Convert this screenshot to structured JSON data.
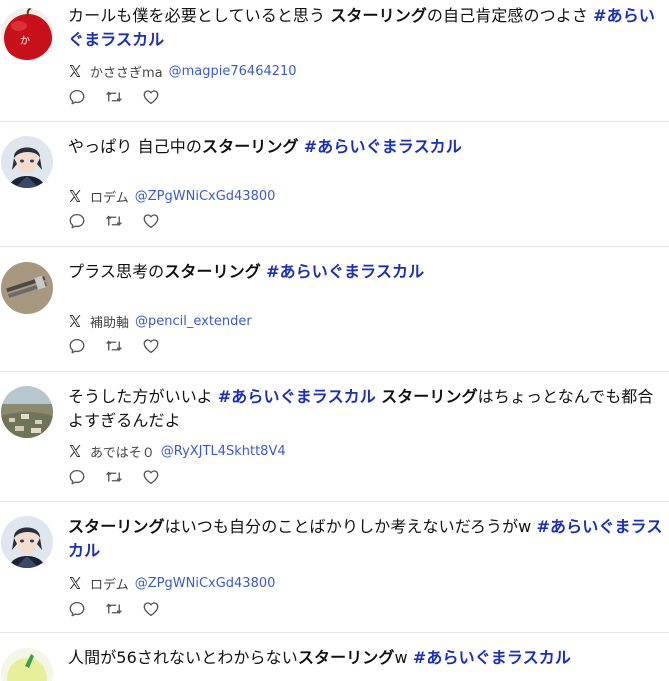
{
  "posts": [
    {
      "text_segments": [
        {
          "text": "カールも僕を必要としていると思う ",
          "style": "normal"
        },
        {
          "text": "スターリング",
          "style": "bold"
        },
        {
          "text": "の自己肯定感のつよさ ",
          "style": "normal"
        },
        {
          "text": "#あらいぐまラスカル",
          "style": "hashtag"
        }
      ],
      "display_name": "かささぎma",
      "handle": "@magpie76464210",
      "avatar": "red-apple-avatar"
    },
    {
      "text_segments": [
        {
          "text": "やっぱり 自己中の",
          "style": "normal"
        },
        {
          "text": "スターリング",
          "style": "bold"
        },
        {
          "text": " ",
          "style": "normal"
        },
        {
          "text": "#あらいぐまラスカル",
          "style": "hashtag"
        }
      ],
      "display_name": "ロデム",
      "handle": "@ZPgWNiCxGd43800",
      "avatar": "anime-character-avatar"
    },
    {
      "text_segments": [
        {
          "text": "プラス思考の",
          "style": "normal"
        },
        {
          "text": "スターリング",
          "style": "bold"
        },
        {
          "text": " ",
          "style": "normal"
        },
        {
          "text": "#あらいぐまラスカル",
          "style": "hashtag"
        }
      ],
      "display_name": "補助軸",
      "handle": "@pencil_extender",
      "avatar": "pencils-avatar"
    },
    {
      "text_segments": [
        {
          "text": "そうした方がいいよ ",
          "style": "normal"
        },
        {
          "text": "#あらいぐまラスカル",
          "style": "hashtag"
        },
        {
          "text": " ",
          "style": "normal"
        },
        {
          "text": "スターリング",
          "style": "bold"
        },
        {
          "text": "はちょっとなんでも都合よすぎるんだよ",
          "style": "normal"
        }
      ],
      "display_name": "あではそ０",
      "handle": "@RyXJTL4Skhtt8V4",
      "avatar": "aerial-city-avatar"
    },
    {
      "text_segments": [
        {
          "text": "スターリング",
          "style": "bold"
        },
        {
          "text": "はいつも自分のことばかりしか考えないだろうがw ",
          "style": "normal"
        },
        {
          "text": "#あらいぐまラスカル",
          "style": "hashtag"
        }
      ],
      "display_name": "ロデム",
      "handle": "@ZPgWNiCxGd43800",
      "avatar": "anime-character-avatar"
    },
    {
      "text_segments": [
        {
          "text": "人間が56されないとわからない",
          "style": "normal"
        },
        {
          "text": "スターリング",
          "style": "bold"
        },
        {
          "text": "w ",
          "style": "normal"
        },
        {
          "text": "#あらいぐまラスカル",
          "style": "hashtag"
        }
      ],
      "display_name": "",
      "handle": "",
      "avatar": "yellow-green-avatar"
    }
  ],
  "icons": {
    "source": "x-logo-icon",
    "reply": "reply-icon",
    "retweet": "retweet-icon",
    "like": "heart-icon"
  },
  "colors": {
    "hashtag": "#1a2fb5",
    "handle": "#3a5bc7",
    "divider": "#e6e6e6"
  }
}
